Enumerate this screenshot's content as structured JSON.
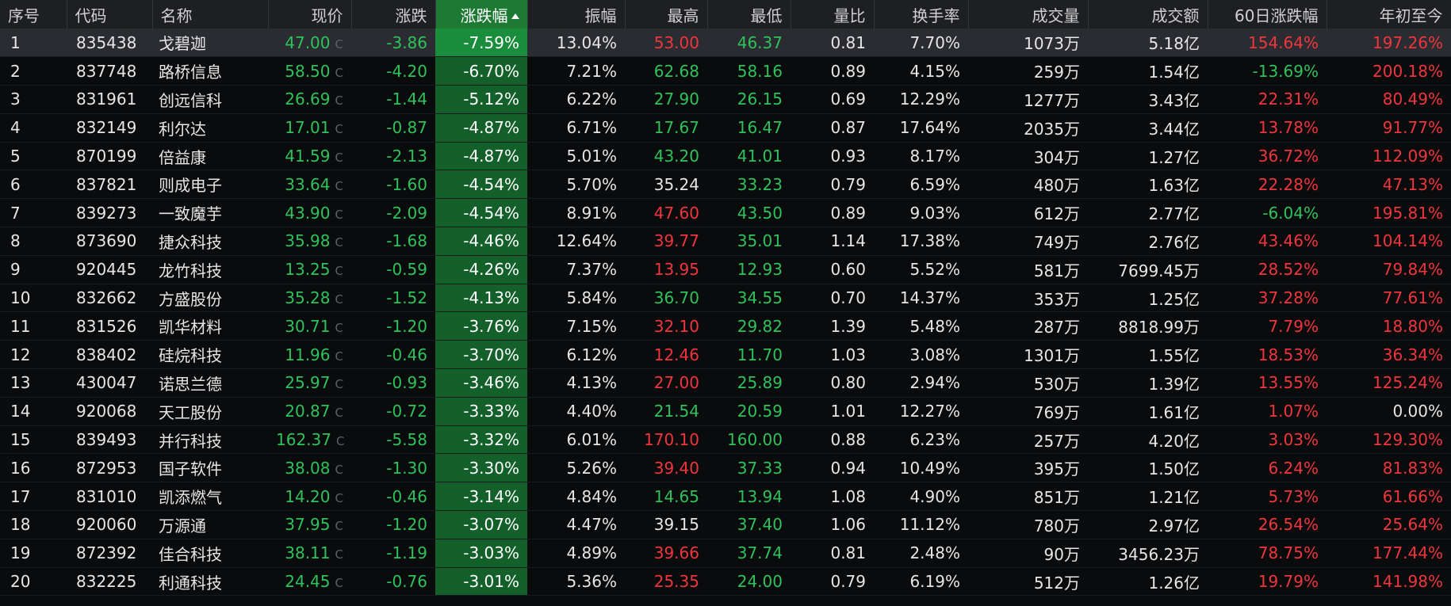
{
  "colors": {
    "up": "#f0363d",
    "down": "#2fc25b",
    "neutral": "#e6e6e6",
    "sorted_header": "#1c7a33",
    "sorted_cell": "#14602a",
    "selected_row": "#2a2c31"
  },
  "table": {
    "sort_column": "pct",
    "sort_direction": "ascending",
    "selected_row": 0,
    "headers": {
      "idx": "序号",
      "code": "代码",
      "name": "名称",
      "price": "现价",
      "chg": "涨跌",
      "pct": "涨跌幅",
      "amp": "振幅",
      "high": "最高",
      "low": "最低",
      "vr": "量比",
      "turn": "换手率",
      "vol": "成交量",
      "amt": "成交额",
      "d60": "60日涨跌幅",
      "ytd": "年初至今"
    },
    "price_suffix": "C",
    "rows": [
      {
        "idx": "1",
        "code": "835438",
        "name": "戈碧迦",
        "price": "47.00",
        "chg": "-3.86",
        "pct": "-7.59%",
        "amp": "13.04%",
        "high": "53.00",
        "low": "46.37",
        "vr": "0.81",
        "turn": "7.70%",
        "vol": "1073万",
        "amt": "5.18亿",
        "d60": "154.64%",
        "ytd": "197.26%",
        "price_c": "down",
        "high_c": "up",
        "low_c": "down",
        "d60_c": "up",
        "ytd_c": "up"
      },
      {
        "idx": "2",
        "code": "837748",
        "name": "路桥信息",
        "price": "58.50",
        "chg": "-4.20",
        "pct": "-6.70%",
        "amp": "7.21%",
        "high": "62.68",
        "low": "58.16",
        "vr": "0.89",
        "turn": "4.15%",
        "vol": "259万",
        "amt": "1.54亿",
        "d60": "-13.69%",
        "ytd": "200.18%",
        "price_c": "down",
        "high_c": "down",
        "low_c": "down",
        "d60_c": "down",
        "ytd_c": "up"
      },
      {
        "idx": "3",
        "code": "831961",
        "name": "创远信科",
        "price": "26.69",
        "chg": "-1.44",
        "pct": "-5.12%",
        "amp": "6.22%",
        "high": "27.90",
        "low": "26.15",
        "vr": "0.69",
        "turn": "12.29%",
        "vol": "1277万",
        "amt": "3.43亿",
        "d60": "22.31%",
        "ytd": "80.49%",
        "price_c": "down",
        "high_c": "down",
        "low_c": "down",
        "d60_c": "up",
        "ytd_c": "up"
      },
      {
        "idx": "4",
        "code": "832149",
        "name": "利尔达",
        "price": "17.01",
        "chg": "-0.87",
        "pct": "-4.87%",
        "amp": "6.71%",
        "high": "17.67",
        "low": "16.47",
        "vr": "0.87",
        "turn": "17.64%",
        "vol": "2035万",
        "amt": "3.44亿",
        "d60": "13.78%",
        "ytd": "91.77%",
        "price_c": "down",
        "high_c": "down",
        "low_c": "down",
        "d60_c": "up",
        "ytd_c": "up"
      },
      {
        "idx": "5",
        "code": "870199",
        "name": "倍益康",
        "price": "41.59",
        "chg": "-2.13",
        "pct": "-4.87%",
        "amp": "5.01%",
        "high": "43.20",
        "low": "41.01",
        "vr": "0.93",
        "turn": "8.17%",
        "vol": "304万",
        "amt": "1.27亿",
        "d60": "36.72%",
        "ytd": "112.09%",
        "price_c": "down",
        "high_c": "down",
        "low_c": "down",
        "d60_c": "up",
        "ytd_c": "up"
      },
      {
        "idx": "6",
        "code": "837821",
        "name": "则成电子",
        "price": "33.64",
        "chg": "-1.60",
        "pct": "-4.54%",
        "amp": "5.70%",
        "high": "35.24",
        "low": "33.23",
        "vr": "0.79",
        "turn": "6.59%",
        "vol": "480万",
        "amt": "1.63亿",
        "d60": "22.28%",
        "ytd": "47.13%",
        "price_c": "down",
        "high_c": "neutral",
        "low_c": "down",
        "d60_c": "up",
        "ytd_c": "up"
      },
      {
        "idx": "7",
        "code": "839273",
        "name": "一致魔芋",
        "price": "43.90",
        "chg": "-2.09",
        "pct": "-4.54%",
        "amp": "8.91%",
        "high": "47.60",
        "low": "43.50",
        "vr": "0.89",
        "turn": "9.03%",
        "vol": "612万",
        "amt": "2.77亿",
        "d60": "-6.04%",
        "ytd": "195.81%",
        "price_c": "down",
        "high_c": "up",
        "low_c": "down",
        "d60_c": "down",
        "ytd_c": "up"
      },
      {
        "idx": "8",
        "code": "873690",
        "name": "捷众科技",
        "price": "35.98",
        "chg": "-1.68",
        "pct": "-4.46%",
        "amp": "12.64%",
        "high": "39.77",
        "low": "35.01",
        "vr": "1.14",
        "turn": "17.38%",
        "vol": "749万",
        "amt": "2.76亿",
        "d60": "43.46%",
        "ytd": "104.14%",
        "price_c": "down",
        "high_c": "up",
        "low_c": "down",
        "d60_c": "up",
        "ytd_c": "up"
      },
      {
        "idx": "9",
        "code": "920445",
        "name": "龙竹科技",
        "price": "13.25",
        "chg": "-0.59",
        "pct": "-4.26%",
        "amp": "7.37%",
        "high": "13.95",
        "low": "12.93",
        "vr": "0.60",
        "turn": "5.52%",
        "vol": "581万",
        "amt": "7699.45万",
        "d60": "28.52%",
        "ytd": "79.84%",
        "price_c": "down",
        "high_c": "up",
        "low_c": "down",
        "d60_c": "up",
        "ytd_c": "up"
      },
      {
        "idx": "10",
        "code": "832662",
        "name": "方盛股份",
        "price": "35.28",
        "chg": "-1.52",
        "pct": "-4.13%",
        "amp": "5.84%",
        "high": "36.70",
        "low": "34.55",
        "vr": "0.70",
        "turn": "14.37%",
        "vol": "353万",
        "amt": "1.25亿",
        "d60": "37.28%",
        "ytd": "77.61%",
        "price_c": "down",
        "high_c": "down",
        "low_c": "down",
        "d60_c": "up",
        "ytd_c": "up"
      },
      {
        "idx": "11",
        "code": "831526",
        "name": "凯华材料",
        "price": "30.71",
        "chg": "-1.20",
        "pct": "-3.76%",
        "amp": "7.15%",
        "high": "32.10",
        "low": "29.82",
        "vr": "1.39",
        "turn": "5.48%",
        "vol": "287万",
        "amt": "8818.99万",
        "d60": "7.79%",
        "ytd": "18.80%",
        "price_c": "down",
        "high_c": "up",
        "low_c": "down",
        "d60_c": "up",
        "ytd_c": "up"
      },
      {
        "idx": "12",
        "code": "838402",
        "name": "硅烷科技",
        "price": "11.96",
        "chg": "-0.46",
        "pct": "-3.70%",
        "amp": "6.12%",
        "high": "12.46",
        "low": "11.70",
        "vr": "1.03",
        "turn": "3.08%",
        "vol": "1301万",
        "amt": "1.55亿",
        "d60": "18.53%",
        "ytd": "36.34%",
        "price_c": "down",
        "high_c": "up",
        "low_c": "down",
        "d60_c": "up",
        "ytd_c": "up"
      },
      {
        "idx": "13",
        "code": "430047",
        "name": "诺思兰德",
        "price": "25.97",
        "chg": "-0.93",
        "pct": "-3.46%",
        "amp": "4.13%",
        "high": "27.00",
        "low": "25.89",
        "vr": "0.80",
        "turn": "2.94%",
        "vol": "530万",
        "amt": "1.39亿",
        "d60": "13.55%",
        "ytd": "125.24%",
        "price_c": "down",
        "high_c": "up",
        "low_c": "down",
        "d60_c": "up",
        "ytd_c": "up"
      },
      {
        "idx": "14",
        "code": "920068",
        "name": "天工股份",
        "price": "20.87",
        "chg": "-0.72",
        "pct": "-3.33%",
        "amp": "4.40%",
        "high": "21.54",
        "low": "20.59",
        "vr": "1.01",
        "turn": "12.27%",
        "vol": "769万",
        "amt": "1.61亿",
        "d60": "1.07%",
        "ytd": "0.00%",
        "price_c": "down",
        "high_c": "down",
        "low_c": "down",
        "d60_c": "up",
        "ytd_c": "neutral"
      },
      {
        "idx": "15",
        "code": "839493",
        "name": "并行科技",
        "price": "162.37",
        "chg": "-5.58",
        "pct": "-3.32%",
        "amp": "6.01%",
        "high": "170.10",
        "low": "160.00",
        "vr": "0.88",
        "turn": "6.23%",
        "vol": "257万",
        "amt": "4.20亿",
        "d60": "3.03%",
        "ytd": "129.30%",
        "price_c": "down",
        "high_c": "up",
        "low_c": "down",
        "d60_c": "up",
        "ytd_c": "up"
      },
      {
        "idx": "16",
        "code": "872953",
        "name": "国子软件",
        "price": "38.08",
        "chg": "-1.30",
        "pct": "-3.30%",
        "amp": "5.26%",
        "high": "39.40",
        "low": "37.33",
        "vr": "0.94",
        "turn": "10.49%",
        "vol": "395万",
        "amt": "1.50亿",
        "d60": "6.24%",
        "ytd": "81.83%",
        "price_c": "down",
        "high_c": "up",
        "low_c": "down",
        "d60_c": "up",
        "ytd_c": "up"
      },
      {
        "idx": "17",
        "code": "831010",
        "name": "凯添燃气",
        "price": "14.20",
        "chg": "-0.46",
        "pct": "-3.14%",
        "amp": "4.84%",
        "high": "14.65",
        "low": "13.94",
        "vr": "1.08",
        "turn": "4.90%",
        "vol": "851万",
        "amt": "1.21亿",
        "d60": "5.73%",
        "ytd": "61.66%",
        "price_c": "down",
        "high_c": "down",
        "low_c": "down",
        "d60_c": "up",
        "ytd_c": "up"
      },
      {
        "idx": "18",
        "code": "920060",
        "name": "万源通",
        "price": "37.95",
        "chg": "-1.20",
        "pct": "-3.07%",
        "amp": "4.47%",
        "high": "39.15",
        "low": "37.40",
        "vr": "1.06",
        "turn": "11.12%",
        "vol": "780万",
        "amt": "2.97亿",
        "d60": "26.54%",
        "ytd": "25.64%",
        "price_c": "down",
        "high_c": "neutral",
        "low_c": "down",
        "d60_c": "up",
        "ytd_c": "up"
      },
      {
        "idx": "19",
        "code": "872392",
        "name": "佳合科技",
        "price": "38.11",
        "chg": "-1.19",
        "pct": "-3.03%",
        "amp": "4.89%",
        "high": "39.66",
        "low": "37.74",
        "vr": "0.81",
        "turn": "2.48%",
        "vol": "90万",
        "amt": "3456.23万",
        "d60": "78.75%",
        "ytd": "177.44%",
        "price_c": "down",
        "high_c": "up",
        "low_c": "down",
        "d60_c": "up",
        "ytd_c": "up"
      },
      {
        "idx": "20",
        "code": "832225",
        "name": "利通科技",
        "price": "24.45",
        "chg": "-0.76",
        "pct": "-3.01%",
        "amp": "5.36%",
        "high": "25.35",
        "low": "24.00",
        "vr": "0.79",
        "turn": "6.19%",
        "vol": "512万",
        "amt": "1.26亿",
        "d60": "19.79%",
        "ytd": "141.98%",
        "price_c": "down",
        "high_c": "up",
        "low_c": "down",
        "d60_c": "up",
        "ytd_c": "up"
      }
    ]
  }
}
